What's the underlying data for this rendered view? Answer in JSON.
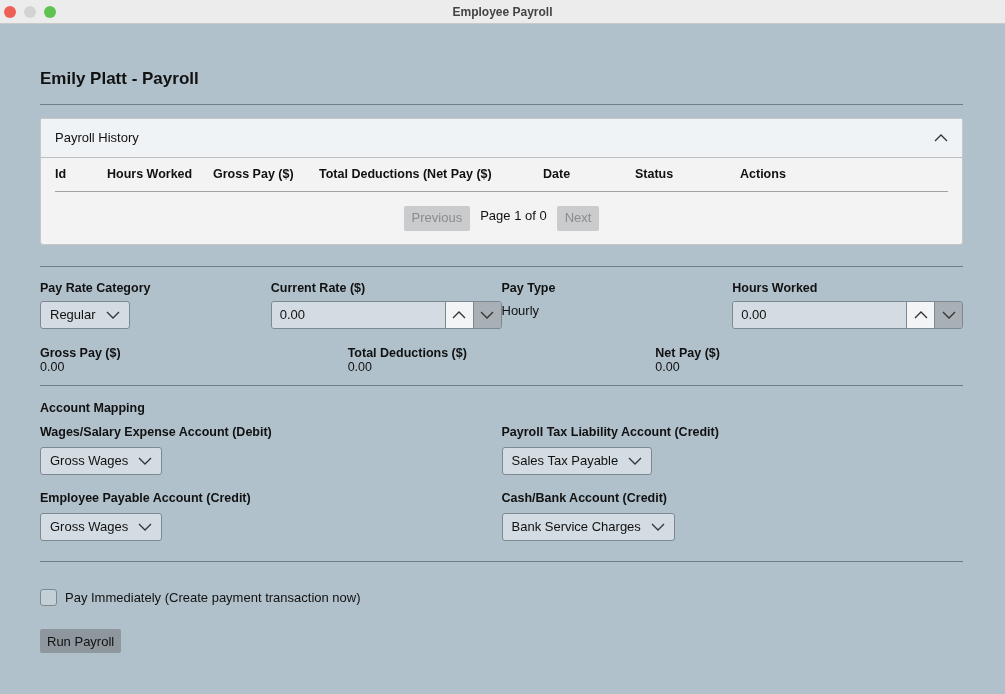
{
  "window": {
    "title": "Employee Payroll"
  },
  "page_title": "Emily Platt - Payroll",
  "history": {
    "title": "Payroll History",
    "expanded": true,
    "columns": [
      "Id",
      "Hours Worked",
      "Gross Pay ($)",
      "Total Deductions (Net Pay ($)",
      "Date",
      "Status",
      "Actions"
    ],
    "pagination": {
      "previous": {
        "label": "Previous",
        "disabled": true
      },
      "page_text": "Page 1 of 0",
      "next": {
        "label": "Next",
        "disabled": true
      }
    }
  },
  "fields": [
    {
      "kind": "select",
      "label": "Pay Rate Category",
      "value": "Regular"
    },
    {
      "kind": "number",
      "label": "Current Rate ($)",
      "value": "0.00"
    },
    {
      "kind": "text",
      "label": "Pay Type",
      "value": "Hourly"
    },
    {
      "kind": "number",
      "label": "Hours Worked",
      "value": "0.00"
    }
  ],
  "totals": [
    {
      "label": "Gross Pay ($)",
      "value": "0.00"
    },
    {
      "label": "Total Deductions ($)",
      "value": "0.00"
    },
    {
      "label": "Net Pay ($)",
      "value": "0.00"
    }
  ],
  "account_mapping": {
    "title": "Account Mapping",
    "accounts": [
      {
        "label": "Wages/Salary Expense Account (Debit)",
        "value": "Gross Wages"
      },
      {
        "label": "Payroll Tax Liability Account (Credit)",
        "value": "Sales Tax Payable"
      },
      {
        "label": "Employee Payable Account (Credit)",
        "value": "Gross Wages"
      },
      {
        "label": "Cash/Bank Account (Credit)",
        "value": "Bank Service Charges"
      }
    ]
  },
  "pay_immediately": {
    "label": "Pay Immediately (Create payment transaction now)",
    "checked": false
  },
  "run_button": {
    "label": "Run Payroll"
  }
}
